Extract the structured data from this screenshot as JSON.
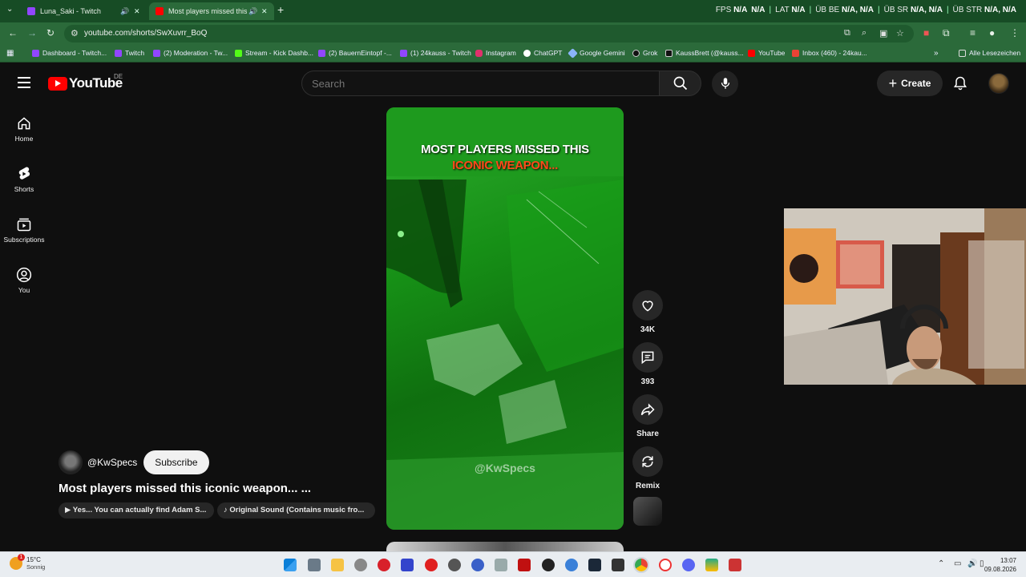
{
  "browser": {
    "tabs": [
      {
        "title": "Luna_Saki - Twitch",
        "favicon_color": "#9146ff"
      },
      {
        "title": "Most players missed this ic",
        "favicon_color": "#ff0000"
      }
    ],
    "stats": [
      {
        "label": "FPS",
        "value": "N/A"
      },
      {
        "label": "N/A",
        "value": ""
      },
      {
        "label": "LAT",
        "value": "N/A"
      },
      {
        "label": "ÜB BE",
        "value": "N/A, N/A"
      },
      {
        "label": "ÜB SR",
        "value": "N/A, N/A"
      },
      {
        "label": "ÜB STR",
        "value": "N/A, N/A"
      }
    ],
    "url": "youtube.com/shorts/SwXuvrr_BoQ",
    "bookmarks": [
      {
        "label": "Dashboard - Twitch...",
        "color": "#9146ff"
      },
      {
        "label": "Twitch",
        "color": "#9146ff"
      },
      {
        "label": "(2) Moderation - Tw...",
        "color": "#9146ff"
      },
      {
        "label": "Stream - Kick Dashb...",
        "color": "#53fc18"
      },
      {
        "label": "(2) BauernEintopf -...",
        "color": "#9146ff"
      },
      {
        "label": "(1) 24kauss - Twitch",
        "color": "#9146ff"
      },
      {
        "label": "Instagram",
        "color": "#e1306c"
      },
      {
        "label": "ChatGPT",
        "color": "#ffffff"
      },
      {
        "label": "Google Gemini",
        "color": "#8ab4f8"
      },
      {
        "label": "Grok",
        "color": "#000000"
      },
      {
        "label": "KaussBrett (@kauss...",
        "color": "#000000"
      },
      {
        "label": "YouTube",
        "color": "#ff0000"
      },
      {
        "label": "Inbox (460) - 24kau...",
        "color": "#ea4335"
      }
    ],
    "all_bookmarks": "Alle Lesezeichen"
  },
  "youtube": {
    "logo_text": "YouTube",
    "country": "DE",
    "search_placeholder": "Search",
    "create_label": "Create",
    "sidebar": [
      {
        "label": "Home"
      },
      {
        "label": "Shorts"
      },
      {
        "label": "Subscriptions"
      },
      {
        "label": "You"
      }
    ],
    "short": {
      "overlay_line1": "MOST PLAYERS MISSED THIS",
      "overlay_line2": "ICONIC WEAPON...",
      "watermark": "@KwSpecs",
      "channel": "@KwSpecs",
      "subscribe_label": "Subscribe",
      "title": "Most players missed this iconic weapon... ...",
      "chip_description": "Yes... You can actually find Adam S...",
      "chip_sound": "Original Sound (Contains music fro..."
    },
    "actions": {
      "likes": "34K",
      "comments": "393",
      "share": "Share",
      "remix": "Remix"
    }
  },
  "taskbar": {
    "weather_temp": "15°C",
    "weather_desc": "Sonnig",
    "weather_badge": "1",
    "time": "13:07",
    "date": "09.08.2026"
  }
}
